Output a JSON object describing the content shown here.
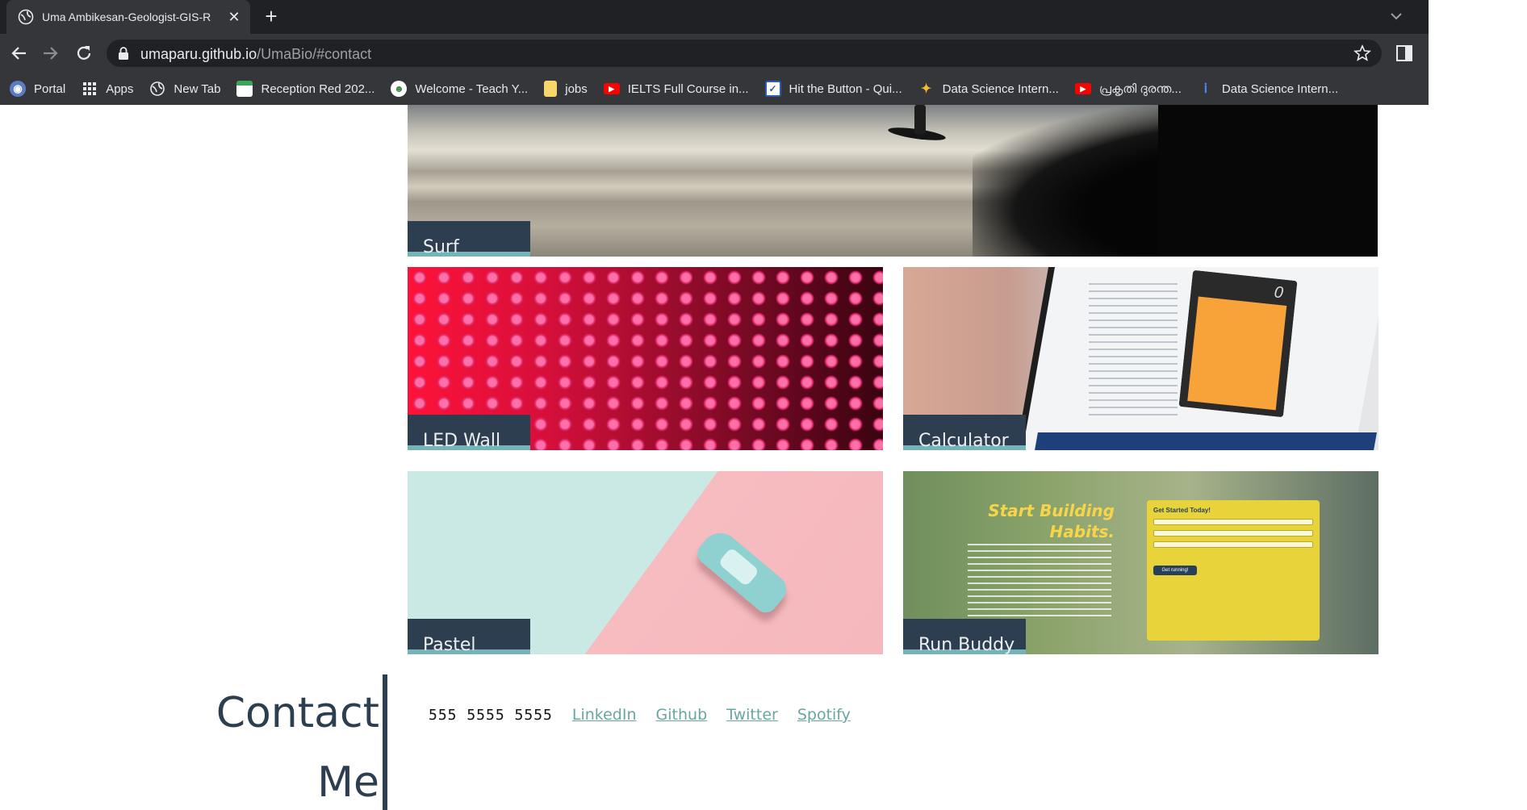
{
  "browser": {
    "tab": {
      "title": "Uma Ambikesan-Geologist-GIS-R",
      "icon": "globe-icon"
    },
    "url": {
      "host": "umaparu.github.io",
      "path": "/UmaBio/#contact"
    },
    "bookmarks": [
      {
        "label": "Portal",
        "icon": "portal-icon"
      },
      {
        "label": "Apps",
        "icon": "apps-grid-icon"
      },
      {
        "label": "New Tab",
        "icon": "globe-icon"
      },
      {
        "label": "Reception Red 202...",
        "icon": "sheet-icon"
      },
      {
        "label": "Welcome - Teach Y...",
        "icon": "teach-icon"
      },
      {
        "label": "jobs",
        "icon": "folder-icon"
      },
      {
        "label": "IELTS Full Course in...",
        "icon": "youtube-icon"
      },
      {
        "label": "Hit the Button - Qui...",
        "icon": "check-icon"
      },
      {
        "label": "Data Science Intern...",
        "icon": "star-logo-icon"
      },
      {
        "label": "പ്രകൃതി ദുരന്ത...",
        "icon": "youtube-icon"
      },
      {
        "label": "Data Science Intern...",
        "icon": "info-icon"
      }
    ]
  },
  "projects": [
    {
      "label": "Surf"
    },
    {
      "label": "LED Wall"
    },
    {
      "label": "Calculator"
    },
    {
      "label": "Pastel"
    },
    {
      "label": "Run Buddy"
    }
  ],
  "run_buddy_image": {
    "headline_1": "Start Building",
    "headline_2": "Habits.",
    "form_title": "Get Started Today!",
    "button": "Get running!"
  },
  "calculator_image": {
    "display": "0"
  },
  "contact": {
    "title_line1": "Contact",
    "title_line2": "Me",
    "phone": "555 5555 5555",
    "links": [
      "LinkedIn",
      "Github",
      "Twitter",
      "Spotify"
    ]
  },
  "colors": {
    "chrome_dark": "#202124",
    "chrome": "#35363a",
    "label_bg": "#2c3e50",
    "label_accent": "#74b3b8",
    "link": "#6aa6a0"
  }
}
